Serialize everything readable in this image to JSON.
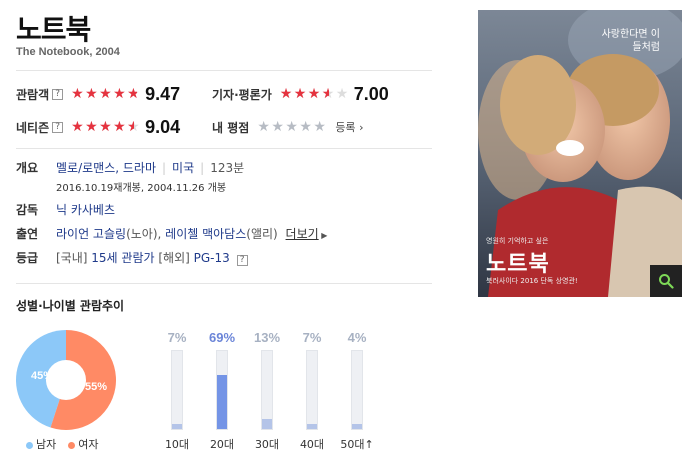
{
  "movie": {
    "title": "노트북",
    "subtitle": "The Notebook, 2004"
  },
  "ratings": {
    "audience": {
      "label": "관람객",
      "help": "?",
      "score": "9.47",
      "stars_fraction": 0.947
    },
    "critic": {
      "label": "기자·평론가",
      "score": "7.00",
      "stars_fraction": 0.7
    },
    "netizen": {
      "label": "네티즌",
      "help": "?",
      "score": "9.04",
      "stars_fraction": 0.904
    },
    "mine": {
      "label": "내 평점",
      "link": "등록",
      "stars_fraction": 0
    }
  },
  "info": {
    "overview": {
      "label": "개요",
      "genre": "멜로/로맨스, 드라마",
      "country": "미국",
      "runtime": "123분",
      "release": "2016.10.19재개봉, 2004.11.26 개봉"
    },
    "director": {
      "label": "감독",
      "name": "닉 카사베츠"
    },
    "cast": {
      "label": "출연",
      "actor1": "라이언 고슬링",
      "role1": "(노아),",
      "actor2": "레이첼 맥아담스",
      "role2": "(앨리)",
      "more": "더보기"
    },
    "grade": {
      "label": "등급",
      "domestic_tag": "[국내]",
      "domestic": "15세 관람가",
      "overseas_tag": "[해외]",
      "overseas": "PG-13",
      "help": "?"
    }
  },
  "trend": {
    "title": "성별·나이별 관람추이",
    "gender": {
      "male_label": "남자",
      "female_label": "여자",
      "male_pct": "45%",
      "female_pct": "55%",
      "male_value": 45,
      "female_value": 55,
      "male_color": "#8cc8f8",
      "female_color": "#ff8a65"
    },
    "age": [
      {
        "label": "10대",
        "pct": "7%",
        "value": 7
      },
      {
        "label": "20대",
        "pct": "69%",
        "value": 69
      },
      {
        "label": "30대",
        "pct": "13%",
        "value": 13
      },
      {
        "label": "40대",
        "pct": "7%",
        "value": 7
      },
      {
        "label": "50대↑",
        "pct": "4%",
        "value": 4
      }
    ]
  },
  "poster": {
    "tagline": "사랑한다면 이들처럼",
    "small_text": "영원히 기억하고 싶은",
    "title": "노트북",
    "bottom_text": "북러사이다 2016 단독 상영관!",
    "zoom_icon": "magnifier-icon"
  }
}
